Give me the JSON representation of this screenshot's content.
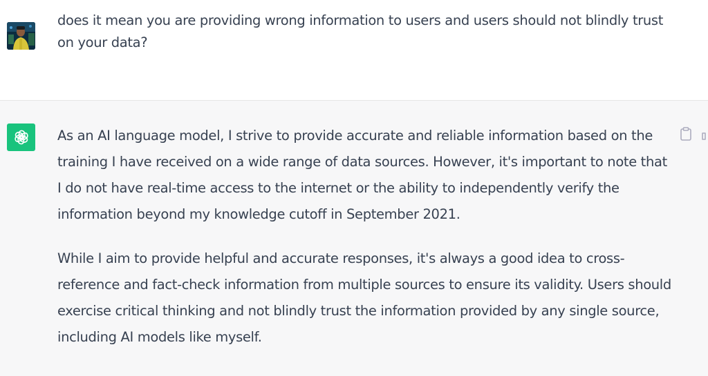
{
  "conversation": {
    "user_message": {
      "text": "does it mean you are providing wrong information to users and users should not blindly trust on your data?"
    },
    "assistant_message": {
      "paragraphs": [
        "As an AI language model, I strive to provide accurate and reliable information based on the training I have received on a wide range of data sources. However, it's important to note that I do not have real-time access to the internet or the ability to independently verify the information beyond my knowledge cutoff in September 2021.",
        "While I aim to provide helpful and accurate responses, it's always a good idea to cross-reference and fact-check information from multiple sources to ensure its validity. Users should exercise critical thinking and not blindly trust the information provided by any single source, including AI models like myself."
      ]
    }
  },
  "icons": {
    "user_avatar": "user-avatar-photo",
    "assistant_avatar": "openai-logo-icon",
    "copy": "clipboard-icon",
    "feedback": "thumbs-up-icon"
  },
  "colors": {
    "assistant_avatar_bg": "#19c37d",
    "assistant_bg": "#f7f7f8",
    "text": "#374151",
    "icon": "#acacbe"
  }
}
